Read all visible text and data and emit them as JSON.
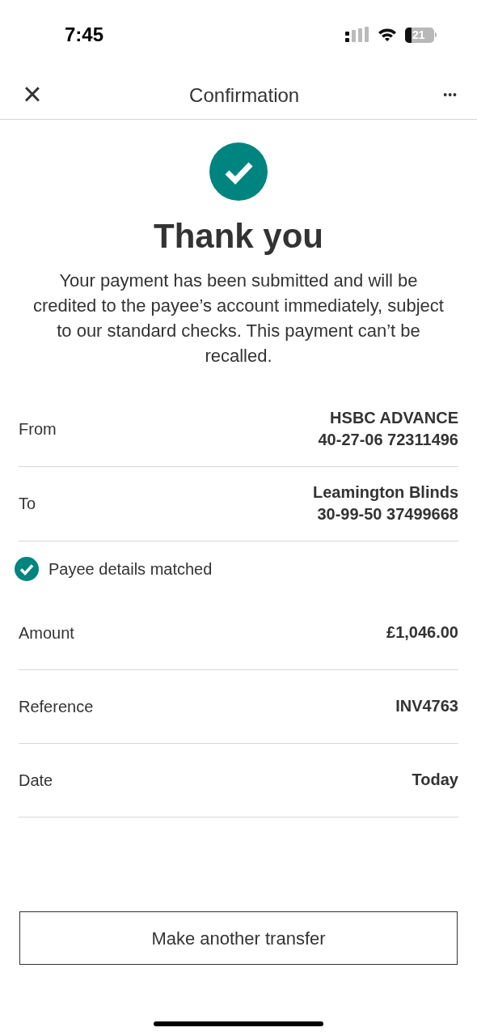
{
  "status_bar": {
    "time": "7:45",
    "battery": "21"
  },
  "header": {
    "title": "Confirmation",
    "close": "×",
    "more": "•••"
  },
  "confirmation": {
    "title": "Thank you",
    "message": "Your payment has been submitted and will be credited to the payee’s account immediately, subject to our standard checks. This payment can’t be recalled."
  },
  "details": [
    {
      "kind": "detail",
      "label": "From",
      "values": [
        "HSBC ADVANCE",
        "40-27-06 72311496"
      ]
    },
    {
      "kind": "detail",
      "label": "To",
      "values": [
        "Leamington Blinds",
        "30-99-50 37499668"
      ]
    },
    {
      "kind": "check",
      "label": "Payee details matched"
    },
    {
      "kind": "detail",
      "label": "Amount",
      "values": [
        "£1,046.00"
      ]
    },
    {
      "kind": "detail",
      "label": "Reference",
      "values": [
        "INV4763"
      ]
    },
    {
      "kind": "detail",
      "label": "Date",
      "values": [
        "Today"
      ]
    }
  ],
  "button": "Make another transfer"
}
